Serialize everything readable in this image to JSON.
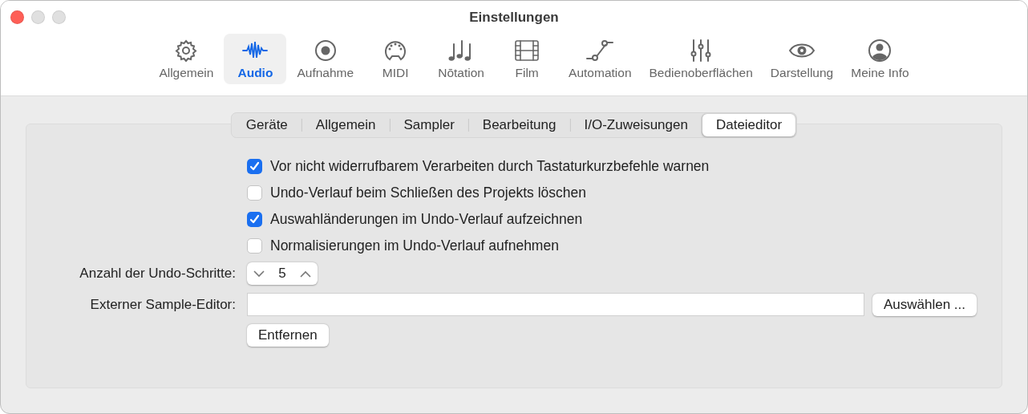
{
  "window": {
    "title": "Einstellungen",
    "buttons": [
      {
        "kind": "close"
      },
      {
        "kind": "minimize"
      },
      {
        "kind": "zoom"
      }
    ]
  },
  "toolbar": [
    {
      "label": "Allgemein",
      "kind": "gear",
      "selected": false
    },
    {
      "label": "Audio",
      "kind": "waveform",
      "selected": true
    },
    {
      "label": "Aufnahme",
      "kind": "record",
      "selected": false
    },
    {
      "label": "MIDI",
      "kind": "midi",
      "selected": false
    },
    {
      "label": "Nōtation",
      "kind": "notes",
      "selected": false
    },
    {
      "label": "Film",
      "kind": "film",
      "selected": false
    },
    {
      "label": "Automation",
      "kind": "automation",
      "selected": false
    },
    {
      "label": "Bedienoberflächen",
      "kind": "sliders",
      "selected": false
    },
    {
      "label": "Darstellung",
      "kind": "eye",
      "selected": false
    },
    {
      "label": "Meine Info",
      "kind": "person",
      "selected": false
    }
  ],
  "tabs": [
    {
      "label": "Geräte",
      "selected": false
    },
    {
      "label": "Allgemein",
      "selected": false
    },
    {
      "label": "Sampler",
      "selected": false
    },
    {
      "label": "Bearbeitung",
      "selected": false
    },
    {
      "label": "I/O-Zuweisungen",
      "selected": false
    },
    {
      "label": "Dateieditor",
      "selected": true
    }
  ],
  "checkboxes": [
    {
      "label": "Vor nicht widerrufbarem Verarbeiten durch Tastaturkurzbefehle warnen",
      "checked": true
    },
    {
      "label": "Undo-Verlauf beim Schließen des Projekts löschen",
      "checked": false
    },
    {
      "label": "Auswahländerungen im Undo-Verlauf aufzeichnen",
      "checked": true
    },
    {
      "label": "Normalisierungen im Undo-Verlauf aufnehmen",
      "checked": false
    }
  ],
  "undo_steps": {
    "label": "Anzahl der Undo-Schritte:",
    "value": "5"
  },
  "external_editor": {
    "label": "Externer Sample-Editor:",
    "choose_button": "Auswählen ...",
    "remove_button": "Entfernen"
  }
}
